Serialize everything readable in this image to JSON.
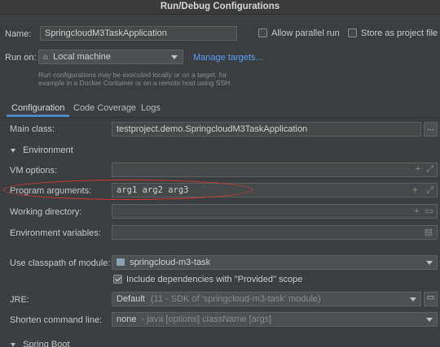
{
  "window": {
    "title": "Run/Debug Configurations"
  },
  "name_row": {
    "label": "Name:",
    "value": "SpringcloudM3TaskApplication",
    "allow_parallel_label": "Allow parallel run",
    "store_as_file_label": "Store as project file"
  },
  "run_on": {
    "label": "Run on:",
    "target": "Local machine",
    "manage_link": "Manage targets...",
    "hint_line1": "Run configurations may be executed locally or on a target: for",
    "hint_line2": "example in a Docker Container or on a remote host using SSH."
  },
  "tabs": [
    {
      "label": "Configuration",
      "active": true
    },
    {
      "label": "Code Coverage",
      "active": false
    },
    {
      "label": "Logs",
      "active": false
    }
  ],
  "main_class": {
    "label": "Main class:",
    "value": "testproject.demo.SpringcloudM3TaskApplication",
    "browse": "..."
  },
  "environment": {
    "header": "Environment",
    "vm_options_label": "VM options:",
    "program_args_label": "Program arguments:",
    "program_args_value": "arg1 arg2 arg3",
    "working_dir_label": "Working directory:",
    "env_vars_label": "Environment variables:"
  },
  "classpath": {
    "label": "Use classpath of module:",
    "module": "springcloud-m3-task",
    "include_provided_label": "Include dependencies with \"Provided\" scope"
  },
  "jre": {
    "label": "JRE:",
    "value": "Default",
    "detail": "(11 - SDK of 'springcloud-m3-task' module)"
  },
  "shorten": {
    "label": "Shorten command line:",
    "value": "none",
    "detail": "- java [options] className [args]"
  },
  "spring_boot": {
    "header": "Spring Boot"
  },
  "colors": {
    "background": "#3c3f41",
    "field": "#45494a",
    "link": "#589df6",
    "annotation": "#d33a2e",
    "tab_accent": "#4a88c7"
  }
}
